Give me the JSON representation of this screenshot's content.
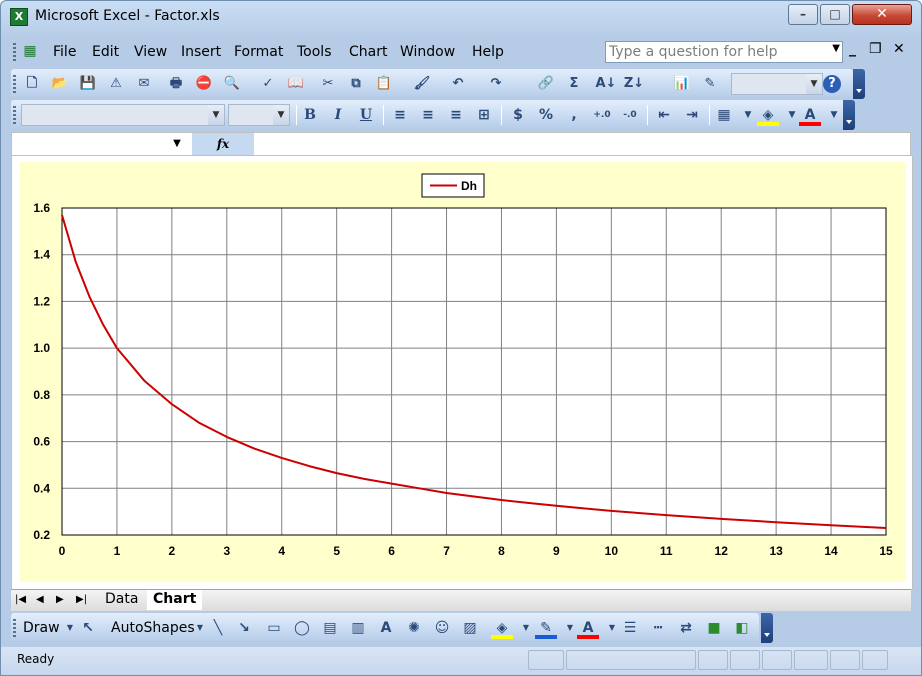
{
  "window": {
    "title": "Microsoft Excel - Factor.xls",
    "app_icon_label": "X",
    "minimize_label": "–",
    "maximize_label": "□",
    "close_label": "✕"
  },
  "menubar": {
    "items": [
      "File",
      "Edit",
      "View",
      "Insert",
      "Format",
      "Tools",
      "Chart",
      "Window",
      "Help"
    ],
    "ask_placeholder": "Type a question for help",
    "mdi_min": "_",
    "mdi_restore": "❐",
    "mdi_close": "✕"
  },
  "standard_toolbar": {
    "icons": [
      "new-icon",
      "open-icon",
      "save-icon",
      "permission-icon",
      "email-icon",
      "print-icon",
      "research-icon",
      "print-preview-icon",
      "spelling-icon",
      "research-book-icon",
      "cut-icon",
      "copy-icon",
      "paste-icon",
      "format-painter-icon",
      "undo-icon",
      "redo-icon",
      "hyperlink-icon",
      "autosum-icon",
      "sort-ascending-icon",
      "sort-descending-icon",
      "chart-wizard-icon",
      "drawing-icon",
      "help-icon"
    ],
    "glyphs": [
      "🗋",
      "📂",
      "💾",
      "⚠",
      "✉",
      "🖶",
      "⛔",
      "🔍",
      "✓",
      "📖",
      "✂",
      "⧉",
      "📋",
      "🖌",
      "↶",
      "↷",
      "🔗",
      "Σ",
      "A↓",
      "Z↓",
      "📊",
      "✎",
      "?"
    ]
  },
  "formatting_toolbar": {
    "bold": "B",
    "italic": "I",
    "underline": "U",
    "currency": "$",
    "percent": "%",
    "comma": ",",
    "increase_decimal": "+.0",
    "decrease_decimal": "-.0"
  },
  "formula_bar": {
    "fx_label": "fx",
    "namebox_value": ""
  },
  "sheet_tabs": [
    "Data",
    "Chart"
  ],
  "active_tab": "Chart",
  "tab_nav": [
    "|◀",
    "◀",
    "▶",
    "▶|"
  ],
  "draw_toolbar": {
    "draw_label": "Draw",
    "autoshapes_label": "AutoShapes"
  },
  "status": {
    "text": "Ready"
  },
  "colors": {
    "series": "#cc0000",
    "plot_bg": "#ffffcc",
    "chart_bg": "#ffffff"
  },
  "chart_data": {
    "type": "line",
    "legend": "top-center",
    "grid": true,
    "xlim": [
      0,
      15
    ],
    "ylim": [
      0.2,
      1.6
    ],
    "x_ticks": [
      0,
      1,
      2,
      3,
      4,
      5,
      6,
      7,
      8,
      9,
      10,
      11,
      12,
      13,
      14,
      15
    ],
    "y_ticks": [
      0.2,
      0.4,
      0.6,
      0.8,
      1.0,
      1.2,
      1.4,
      1.6
    ],
    "y_tick_labels": [
      "0.2",
      "0.4",
      "0.6",
      "0.8",
      "1.0",
      "1.2",
      "1.4",
      "1.6"
    ],
    "series": [
      {
        "name": "Dh",
        "x": [
          0,
          0.25,
          0.5,
          0.75,
          1,
          1.5,
          2,
          2.5,
          3,
          3.5,
          4,
          4.5,
          5,
          5.5,
          6,
          6.5,
          7,
          7.5,
          8,
          8.5,
          9,
          9.5,
          10,
          11,
          12,
          13,
          14,
          15
        ],
        "y": [
          1.57,
          1.37,
          1.22,
          1.1,
          1.0,
          0.86,
          0.76,
          0.68,
          0.62,
          0.57,
          0.53,
          0.495,
          0.465,
          0.44,
          0.42,
          0.4,
          0.38,
          0.365,
          0.35,
          0.337,
          0.325,
          0.314,
          0.303,
          0.285,
          0.269,
          0.255,
          0.242,
          0.23
        ]
      }
    ]
  }
}
